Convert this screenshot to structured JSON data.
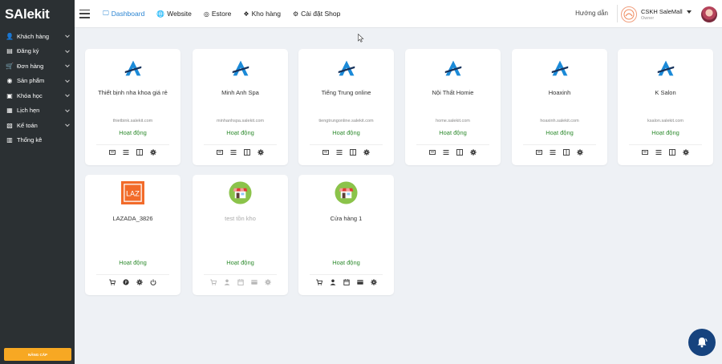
{
  "brand": {
    "name_prefix": "S",
    "name_a": "A",
    "name_suffix": "lekit"
  },
  "sidebar": {
    "items": [
      {
        "label": "Khách hàng",
        "icon": "user-icon",
        "glyph": "👤",
        "has_children": true
      },
      {
        "label": "Đăng ký",
        "icon": "register-icon",
        "glyph": "▤",
        "has_children": true
      },
      {
        "label": "Đơn hàng",
        "icon": "cart-icon",
        "glyph": "🛒",
        "has_children": true
      },
      {
        "label": "Sản phẩm",
        "icon": "product-icon",
        "glyph": "◉",
        "has_children": true
      },
      {
        "label": "Khóa học",
        "icon": "course-icon",
        "glyph": "▣",
        "has_children": true
      },
      {
        "label": "Lịch hẹn",
        "icon": "calendar-icon",
        "glyph": "▦",
        "has_children": true
      },
      {
        "label": "Kế toán",
        "icon": "accounting-icon",
        "glyph": "▧",
        "has_children": true
      },
      {
        "label": "Thống kê",
        "icon": "chart-icon",
        "glyph": "▥",
        "has_children": false
      }
    ],
    "upgrade_label": "NÂNG CẤP"
  },
  "header": {
    "menu": [
      {
        "label": "Dashboard",
        "icon": "monitor-icon",
        "active": true
      },
      {
        "label": "Website",
        "icon": "globe-icon",
        "active": false
      },
      {
        "label": "Estore",
        "icon": "estore-icon",
        "active": false
      },
      {
        "label": "Kho hàng",
        "icon": "layers-icon",
        "active": false
      },
      {
        "label": "Cài đặt Shop",
        "icon": "gear-icon",
        "active": false
      }
    ],
    "help_label": "Hướng dẫn",
    "account": {
      "name": "CSKH SaleMall",
      "role": "Owner"
    }
  },
  "cards": [
    {
      "name": "Thiết bịnh nha khoa giá rẻ",
      "domain": "thietbink.salekit.com",
      "status": "Hoạt động",
      "logo": "salekit",
      "actions": [
        "web",
        "list",
        "layout",
        "gear"
      ]
    },
    {
      "name": "Minh Anh Spa",
      "domain": "minhanhspa.salekit.com",
      "status": "Hoạt động",
      "logo": "salekit",
      "actions": [
        "web",
        "list",
        "layout",
        "gear"
      ]
    },
    {
      "name": "Tiếng Trung online",
      "domain": "tiengtrungonline.salekit.com",
      "status": "Hoạt động",
      "logo": "salekit",
      "actions": [
        "web",
        "list",
        "layout",
        "gear"
      ]
    },
    {
      "name": "Nội Thất Homie",
      "domain": "home.salekit.com",
      "status": "Hoạt động",
      "logo": "salekit",
      "actions": [
        "web",
        "list",
        "layout",
        "gear"
      ]
    },
    {
      "name": "Hoaxinh",
      "domain": "hoaxinh.salekit.com",
      "status": "Hoạt động",
      "logo": "salekit",
      "actions": [
        "web",
        "list",
        "layout",
        "gear"
      ]
    },
    {
      "name": "K Salon",
      "domain": "ksalon.salekit.com",
      "status": "Hoạt động",
      "logo": "salekit",
      "actions": [
        "web",
        "list",
        "layout",
        "gear"
      ]
    },
    {
      "name": "LAZADA_3826",
      "domain": "",
      "status": "Hoạt động",
      "logo": "lazada",
      "actions": [
        "cart",
        "info",
        "gear",
        "power"
      ]
    },
    {
      "name": "test tồn kho",
      "domain": "",
      "status": "Hoạt động",
      "logo": "store",
      "muted": true,
      "actions": [
        "cart",
        "user",
        "calendar",
        "card",
        "gear"
      ]
    },
    {
      "name": "Cửa hàng 1",
      "domain": "",
      "status": "Hoạt động",
      "logo": "store",
      "actions": [
        "cart",
        "user",
        "calendar",
        "card",
        "gear"
      ]
    }
  ],
  "colors": {
    "sidebar_bg": "#2b3033",
    "accent": "#2a84d2",
    "status_green": "#2e8b2e",
    "upgrade": "#f7a823",
    "fab": "#16437e",
    "lazada": "#f26b2a",
    "store_green": "#8bc34a"
  }
}
